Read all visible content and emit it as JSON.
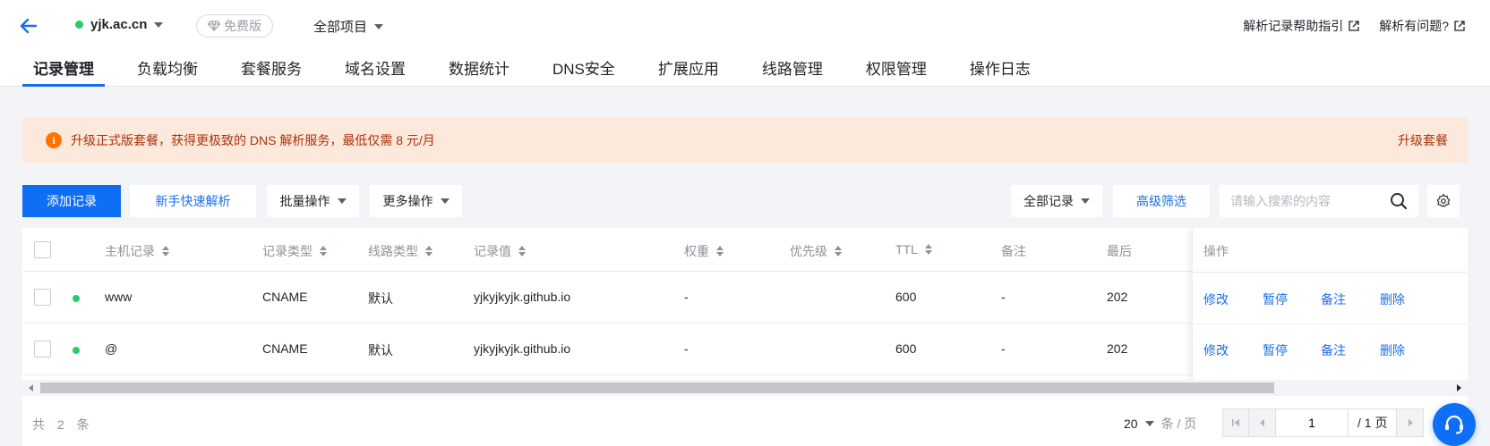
{
  "header": {
    "domain": "yjk.ac.cn",
    "plan_badge": "免费版",
    "project_selector": "全部项目",
    "help_links": [
      "解析记录帮助指引",
      "解析有问题?"
    ]
  },
  "tabs": [
    "记录管理",
    "负载均衡",
    "套餐服务",
    "域名设置",
    "数据统计",
    "DNS安全",
    "扩展应用",
    "线路管理",
    "权限管理",
    "操作日志"
  ],
  "banner": {
    "text": "升级正式版套餐，获得更极致的 DNS 解析服务，最低仅需 8 元/月",
    "action": "升级套餐"
  },
  "toolbar": {
    "add_record": "添加记录",
    "quick_setup": "新手快速解析",
    "batch_ops": "批量操作",
    "more_ops": "更多操作",
    "record_filter": "全部记录",
    "advanced_filter": "高级筛选",
    "search_placeholder": "请输入搜索的内容"
  },
  "table": {
    "headers": {
      "host": "主机记录",
      "type": "记录类型",
      "line": "线路类型",
      "value": "记录值",
      "weight": "权重",
      "priority": "优先级",
      "ttl": "TTL",
      "remark": "备注",
      "last_modified": "最后",
      "ops": "操作"
    },
    "rows": [
      {
        "host": "www",
        "type": "CNAME",
        "line": "默认",
        "value": "yjkyjkyjk.github.io",
        "weight": "-",
        "priority": "",
        "ttl": "600",
        "remark": "-",
        "last_modified": "202"
      },
      {
        "host": "@",
        "type": "CNAME",
        "line": "默认",
        "value": "yjkyjkyjk.github.io",
        "weight": "-",
        "priority": "",
        "ttl": "600",
        "remark": "-",
        "last_modified": "202"
      }
    ],
    "row_actions": [
      "修改",
      "暂停",
      "备注",
      "删除"
    ]
  },
  "footer": {
    "total": "共 2 条",
    "page_size": "20",
    "page_size_unit": "条 / 页",
    "current_page": "1",
    "total_pages": "/ 1 页"
  },
  "colors": {
    "primary": "#0e6ef5",
    "status_green": "#29cc6a",
    "banner_bg": "#fde8dc",
    "banner_text": "#ad3208"
  }
}
